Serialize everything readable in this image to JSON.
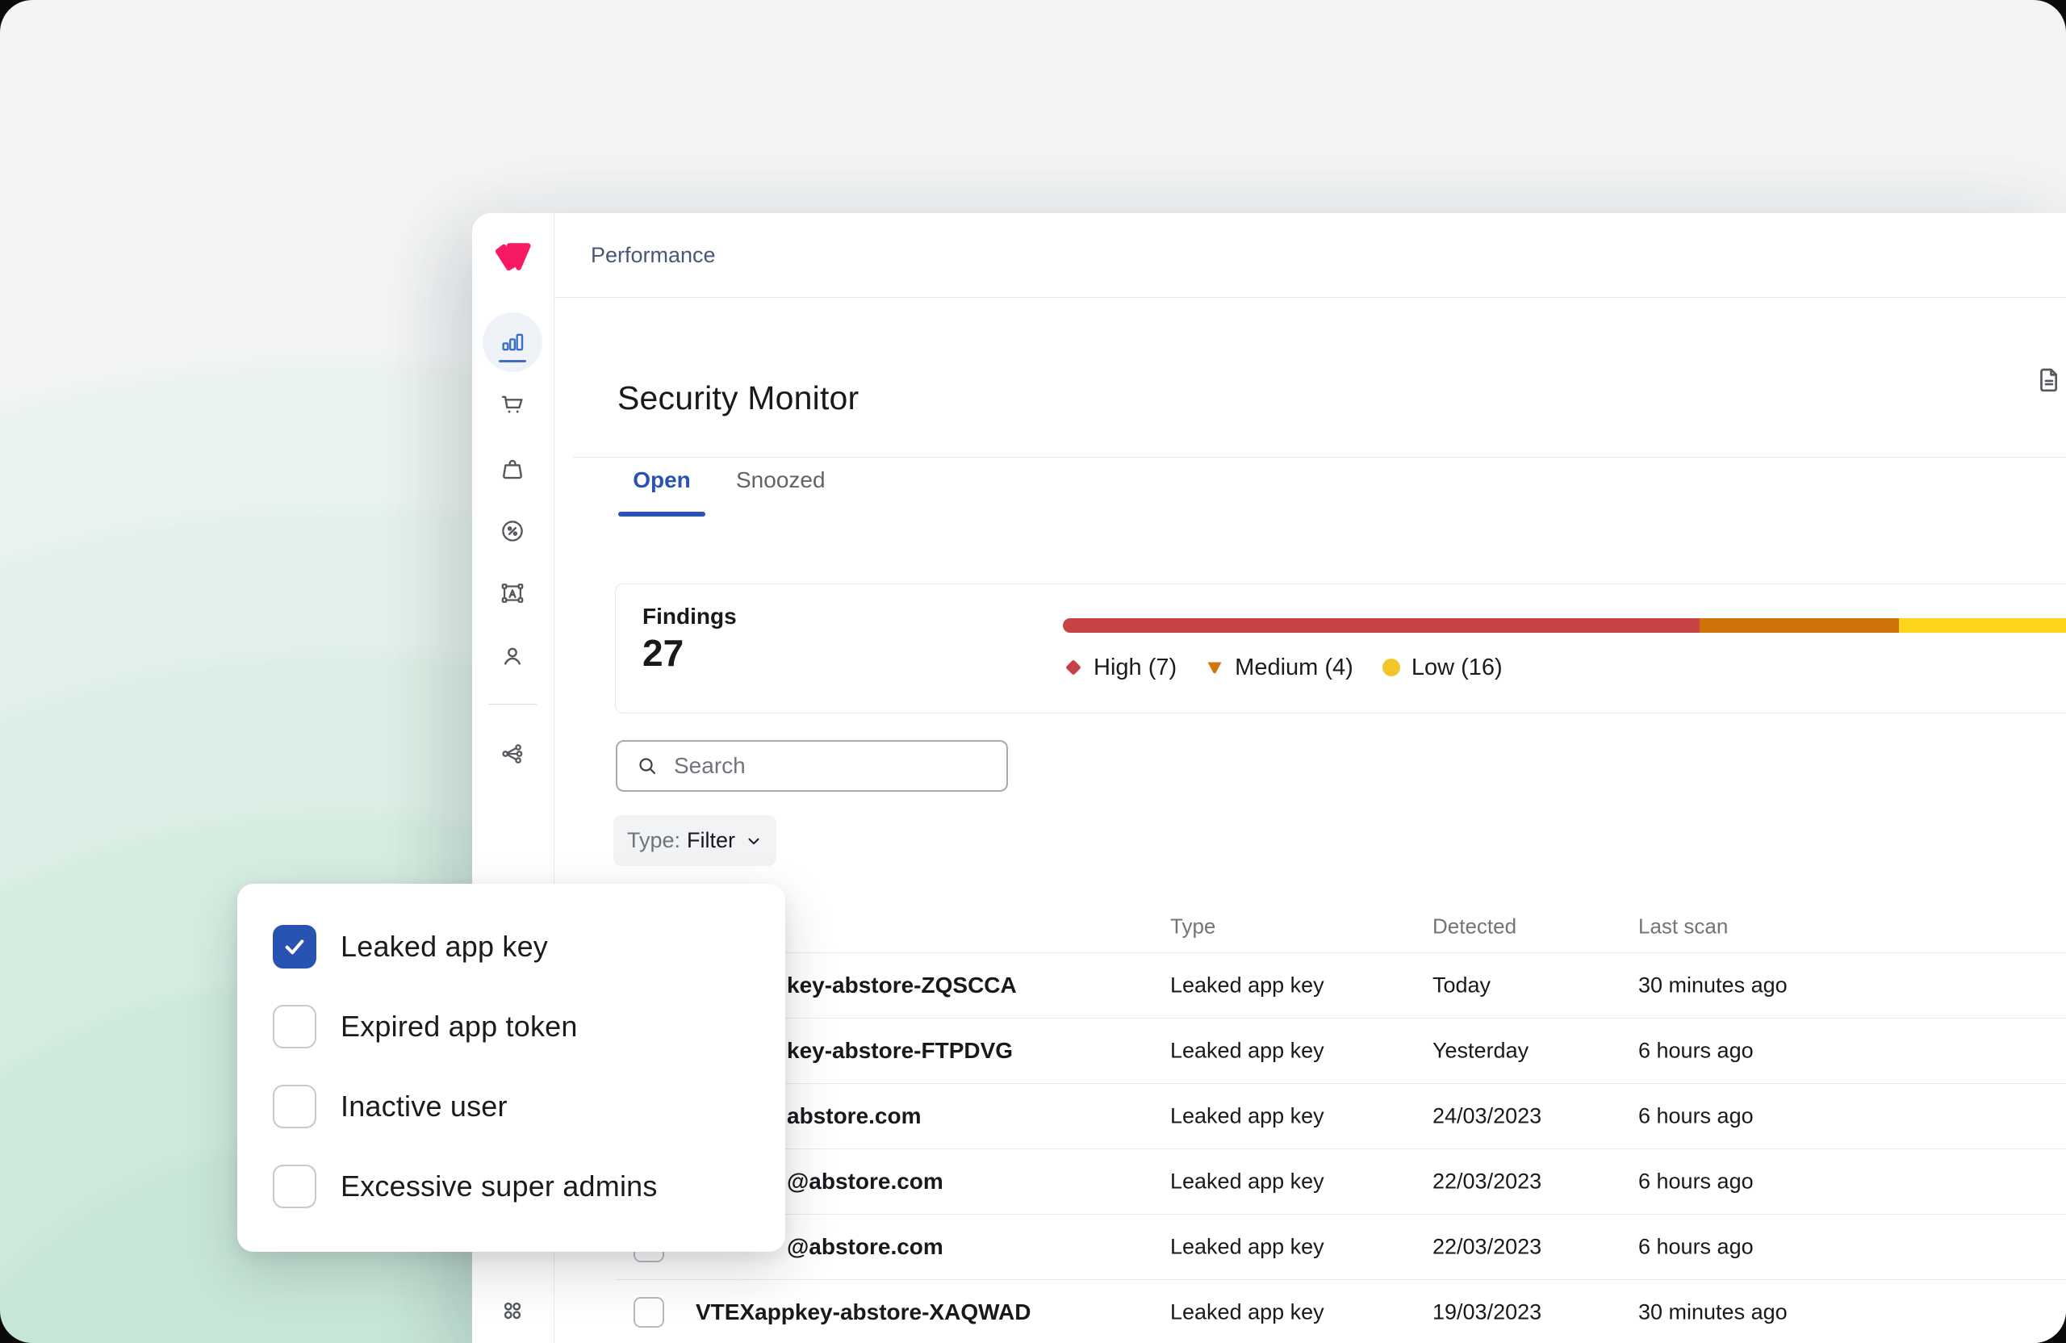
{
  "colors": {
    "accent_blue": "#2953B2",
    "brand_pink": "#F71963",
    "high_red": "#C5424B",
    "medium_orange": "#D2760B",
    "low_yellow": "#F2C62B"
  },
  "topbar": {
    "breadcrumb": "Performance"
  },
  "sidebar": {
    "items": [
      "analytics",
      "orders",
      "catalog",
      "promotions",
      "storefront",
      "customers",
      "integrations",
      "apps"
    ]
  },
  "page": {
    "title": "Security Monitor",
    "tabs": [
      {
        "label": "Open",
        "active": true
      },
      {
        "label": "Snoozed",
        "active": false
      }
    ],
    "findings_card": {
      "label": "Findings",
      "count": "27",
      "severities": [
        {
          "level": "High",
          "count": 7,
          "label": "High (7)",
          "shape": "diamond",
          "color": "#C5424B",
          "bar_color": "#C64444",
          "bar_width_pct": 61.2
        },
        {
          "level": "Medium",
          "count": 4,
          "label": "Medium (4)",
          "shape": "triangle-down",
          "color": "#D2760B",
          "bar_color": "#CE7106",
          "bar_width_pct": 19.1
        },
        {
          "level": "Low",
          "count": 16,
          "label": "Low (16)",
          "shape": "circle",
          "color": "#F2C62B",
          "bar_color": "#FFD41C",
          "bar_width_pct": 19.7
        }
      ]
    },
    "search": {
      "placeholder": "Search"
    },
    "type_filter": {
      "prefix": "Type:",
      "value": "Filter"
    },
    "table": {
      "headers": {
        "type": "Type",
        "detected": "Detected",
        "last_scan": "Last scan"
      },
      "rows": [
        {
          "name": "key-abstore-ZQSCCA",
          "type": "Leaked app key",
          "detected": "Today",
          "last_scan": "30 minutes ago"
        },
        {
          "name": "key-abstore-FTPDVG",
          "type": "Leaked app key",
          "detected": "Yesterday",
          "last_scan": "6 hours ago"
        },
        {
          "name": "abstore.com",
          "type": "Leaked app key",
          "detected": "24/03/2023",
          "last_scan": "6 hours ago"
        },
        {
          "name": "@abstore.com",
          "type": "Leaked app key",
          "detected": "22/03/2023",
          "last_scan": "6 hours ago"
        },
        {
          "name": "@abstore.com",
          "type": "Leaked app key",
          "detected": "22/03/2023",
          "last_scan": "6 hours ago"
        },
        {
          "name": "VTEXappkey-abstore-XAQWAD",
          "type": "Leaked app key",
          "detected": "19/03/2023",
          "last_scan": "30 minutes ago"
        }
      ]
    }
  },
  "filter_dropdown": {
    "options": [
      {
        "label": "Leaked app key",
        "checked": true
      },
      {
        "label": "Expired app token",
        "checked": false
      },
      {
        "label": "Inactive user",
        "checked": false
      },
      {
        "label": "Excessive super admins",
        "checked": false
      }
    ]
  }
}
